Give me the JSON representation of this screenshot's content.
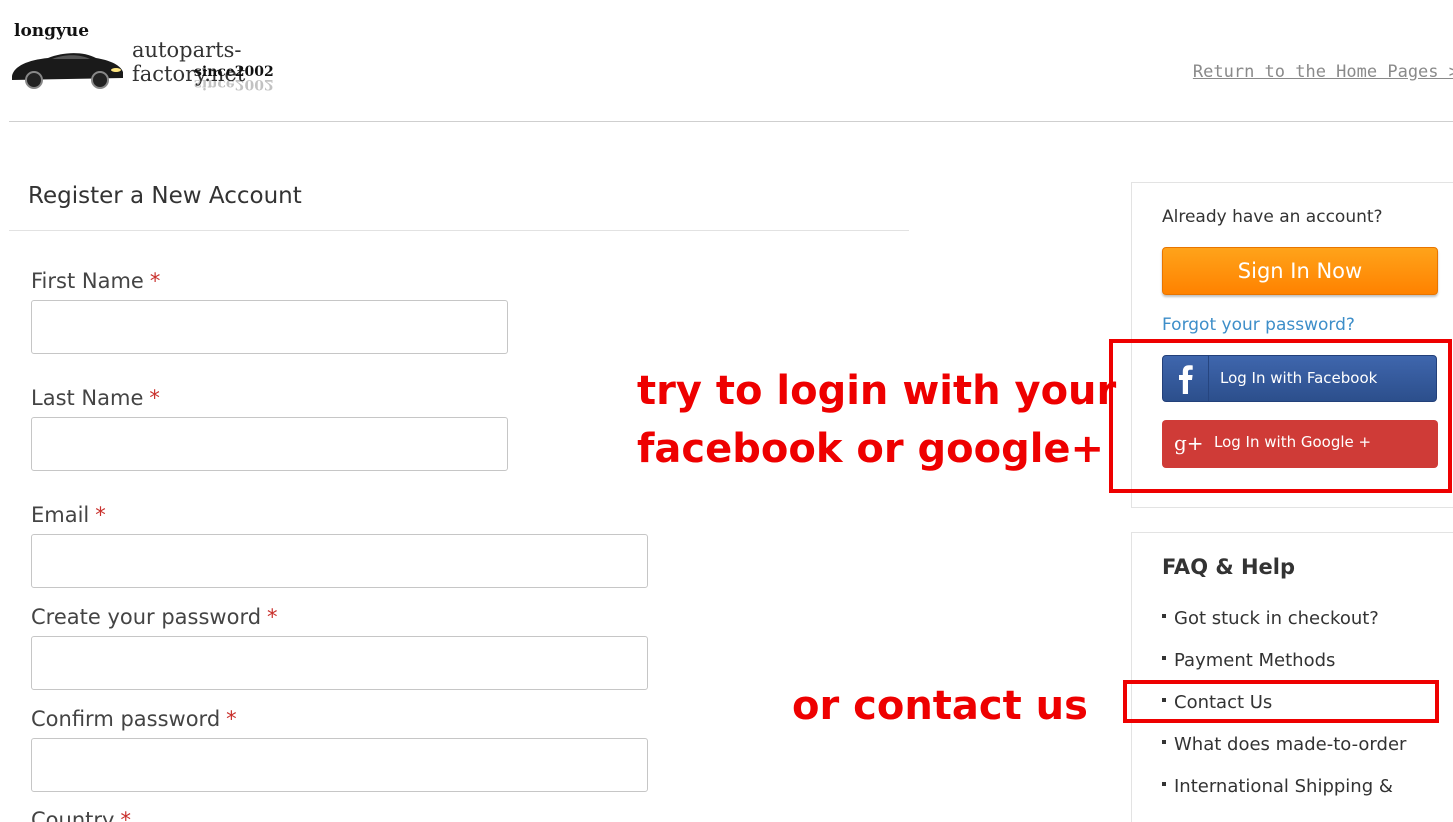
{
  "header": {
    "logo_brand": "longyue",
    "logo_site": "autoparts-factory.net",
    "logo_since": "since2002",
    "home_link": "Return to the Home Pages >"
  },
  "register": {
    "title": "Register a New Account",
    "required_mark": "*",
    "fields": [
      {
        "label": "First Name",
        "value": ""
      },
      {
        "label": "Last Name",
        "value": ""
      },
      {
        "label": "Email",
        "value": ""
      },
      {
        "label": "Create your password",
        "value": ""
      },
      {
        "label": "Confirm password",
        "value": ""
      },
      {
        "label": "Country",
        "value": ""
      }
    ]
  },
  "account": {
    "question": "Already have an account?",
    "sign_in": "Sign In Now",
    "forgot": "Forgot your password?",
    "facebook": "Log In with Facebook",
    "google": "Log In with Google +",
    "google_icon": "g+"
  },
  "faq": {
    "title": "FAQ & Help",
    "items": [
      "Got stuck in checkout?",
      "Payment Methods",
      "Contact Us",
      "What does made-to-order",
      "International Shipping &"
    ]
  },
  "annotations": {
    "login_line1": "try to login with your",
    "login_line2": "facebook or google+",
    "contact": "or contact us",
    "color": "#ee0000"
  },
  "colors": {
    "signin_orange": "#ff8200",
    "facebook_blue": "#3b5998",
    "google_red": "#cf3b37",
    "link_blue": "#3d8ec9",
    "required_red": "#c9302c"
  }
}
